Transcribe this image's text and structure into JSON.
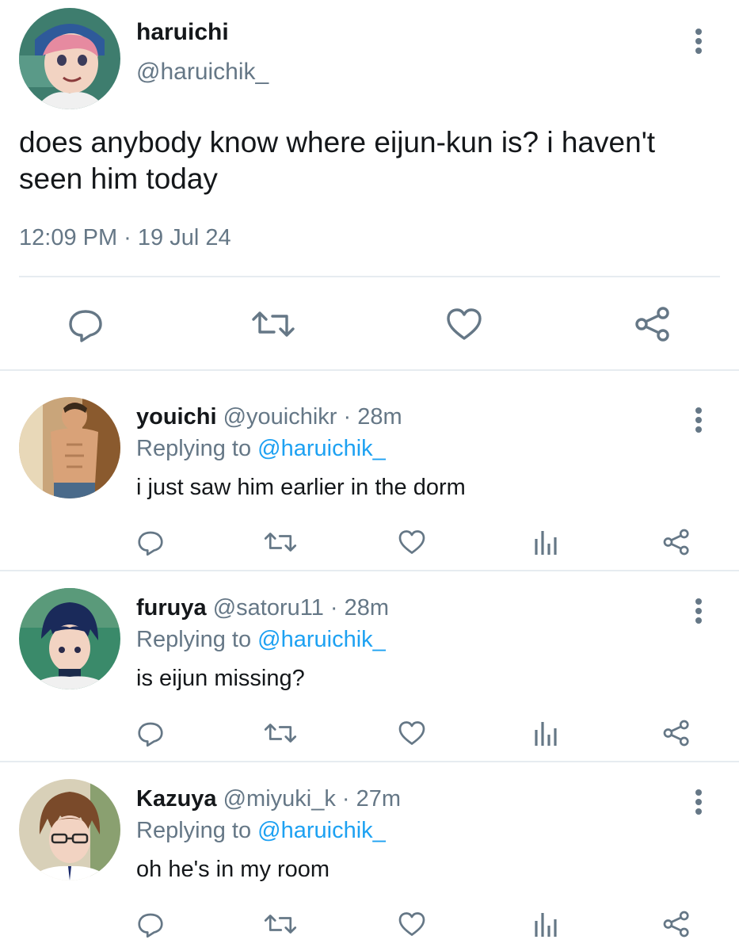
{
  "main_tweet": {
    "author_name": "haruichi",
    "author_handle": "@haruichik_",
    "text": "does anybody know where eijun-kun is? i haven't seen him today",
    "timestamp": "12:09 PM · 19 Jul 24",
    "actions": [
      "reply-icon",
      "retweet-icon",
      "like-icon",
      "share-icon"
    ]
  },
  "replies": [
    {
      "author_name": "youichi",
      "author_handle": "@youichikr",
      "separator": "·",
      "time": "28m",
      "replying_prefix": "Replying to ",
      "replying_to": "@haruichik_",
      "text": "i just saw him earlier in the dorm"
    },
    {
      "author_name": "furuya",
      "author_handle": "@satoru11",
      "separator": "·",
      "time": "28m",
      "replying_prefix": "Replying to ",
      "replying_to": "@haruichik_",
      "text": "is eijun missing?"
    },
    {
      "author_name": "Kazuya",
      "author_handle": "@miyuki_k",
      "separator": "·",
      "time": "27m",
      "replying_prefix": "Replying to ",
      "replying_to": "@haruichik_",
      "text": "oh he's in my room"
    }
  ],
  "colors": {
    "text": "#14171a",
    "secondary": "#657786",
    "mention": "#1da1f2",
    "divider": "#e6ecf0"
  }
}
